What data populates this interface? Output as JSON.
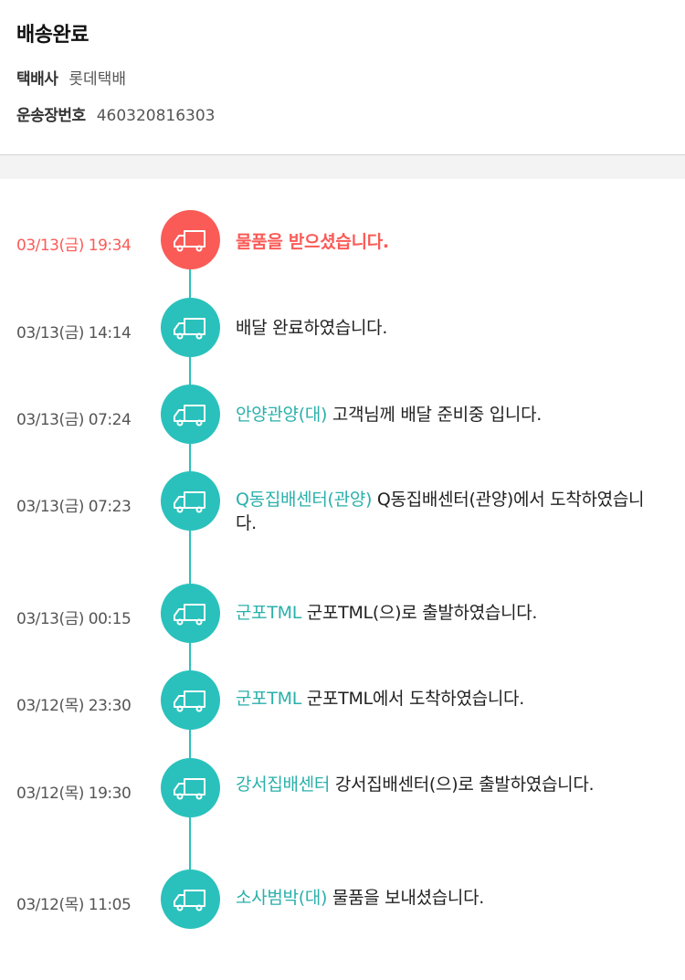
{
  "header": {
    "status": "배송완료",
    "carrier_label": "택배사",
    "carrier_value": "롯데택배",
    "tracking_label": "운송장번호",
    "tracking_value": "460320816303"
  },
  "colors": {
    "accent": "#2ac1bc",
    "active": "#fa5b57",
    "location": "#2ab0ab"
  },
  "timeline": [
    {
      "time": "03/13(금) 19:34",
      "location": "",
      "message": "물품을 받으셨습니다.",
      "icon": "truck-icon",
      "active": true
    },
    {
      "time": "03/13(금) 14:14",
      "location": "",
      "message": "배달 완료하였습니다.",
      "icon": "truck-icon",
      "active": false
    },
    {
      "time": "03/13(금) 07:24",
      "location": "안양관양(대)",
      "message": "고객님께 배달 준비중 입니다.",
      "icon": "truck-icon",
      "active": false
    },
    {
      "time": "03/13(금) 07:23",
      "location": "Q동집배센터(관양)",
      "message": "Q동집배센터(관양)에서 도착하였습니다.",
      "icon": "truck-icon",
      "active": false
    },
    {
      "time": "03/13(금) 00:15",
      "location": "군포TML",
      "message": "군포TML(으)로 출발하였습니다.",
      "icon": "truck-icon",
      "active": false
    },
    {
      "time": "03/12(목) 23:30",
      "location": "군포TML",
      "message": "군포TML에서 도착하였습니다.",
      "icon": "truck-icon",
      "active": false
    },
    {
      "time": "03/12(목) 19:30",
      "location": "강서집배센터",
      "message": "강서집배센터(으)로 출발하였습니다.",
      "icon": "truck-icon",
      "active": false
    },
    {
      "time": "03/12(목) 11:05",
      "location": "소사범박(대)",
      "message": "물품을 보내셨습니다.",
      "icon": "truck-icon",
      "active": false
    }
  ]
}
